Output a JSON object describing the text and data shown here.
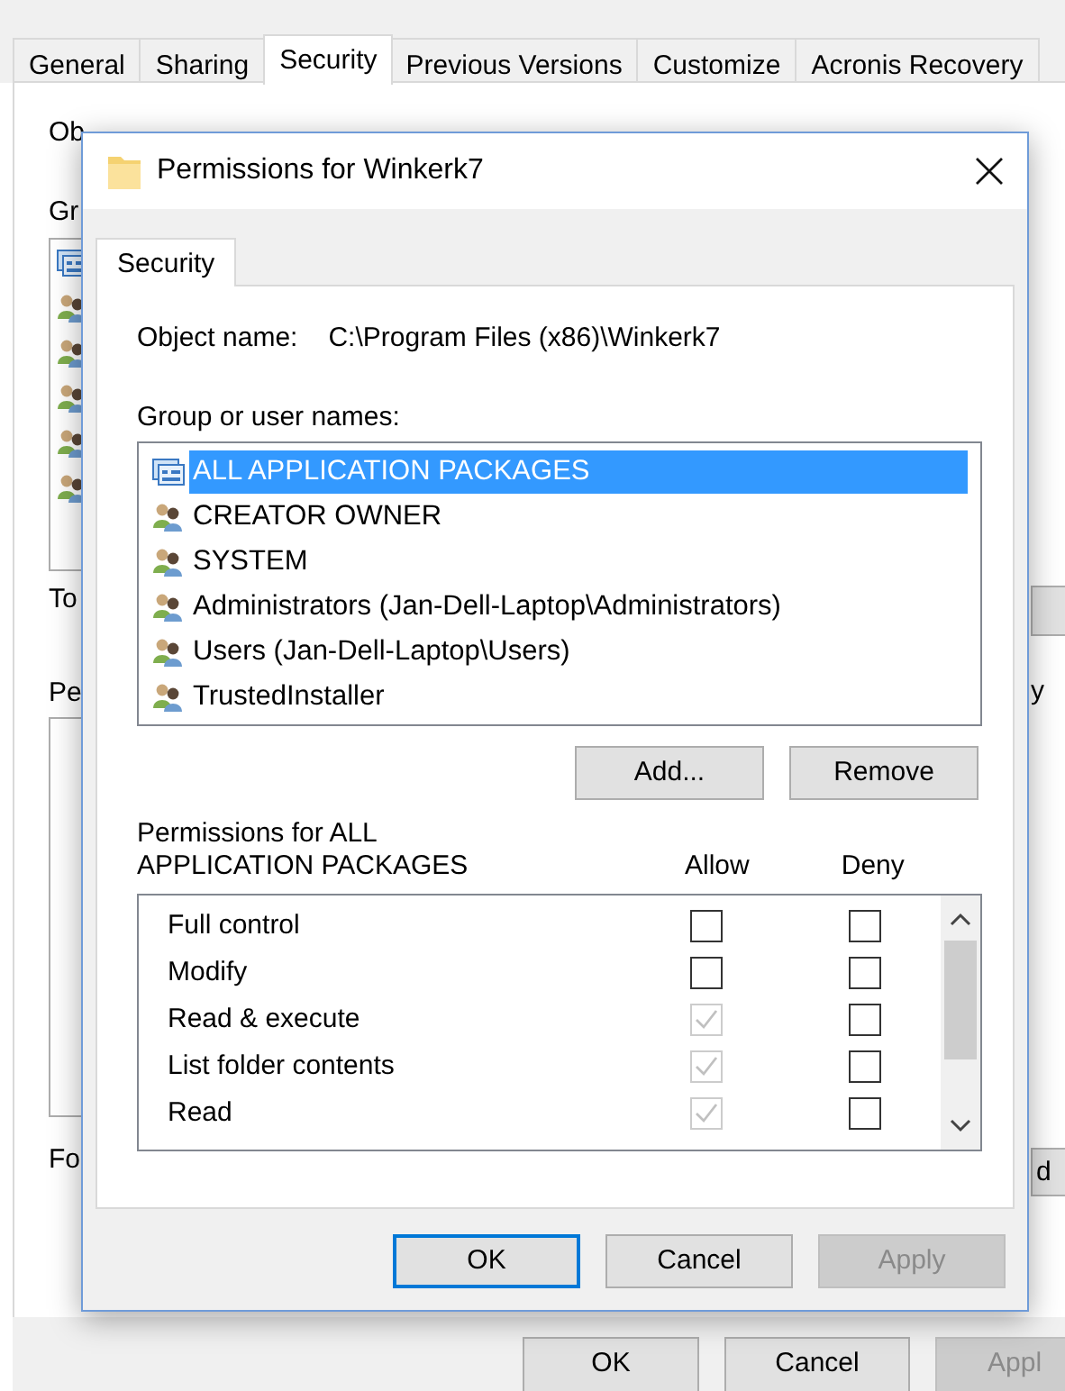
{
  "background_window": {
    "tabs": [
      {
        "label": "General",
        "selected": false
      },
      {
        "label": "Sharing",
        "selected": false
      },
      {
        "label": "Security",
        "selected": true
      },
      {
        "label": "Previous Versions",
        "selected": false
      },
      {
        "label": "Customize",
        "selected": false
      },
      {
        "label": "Acronis Recovery",
        "selected": false
      }
    ],
    "label_fragments": [
      "Ob",
      "Gr",
      "To",
      "Pe",
      "Fo"
    ],
    "right_fragments": [
      "y",
      "d"
    ],
    "buttons": [
      {
        "label": "OK",
        "disabled": false
      },
      {
        "label": "Cancel",
        "disabled": false
      },
      {
        "label": "Appl",
        "disabled": true
      }
    ]
  },
  "dialog": {
    "title": "Permissions for Winkerk7",
    "tabs": [
      {
        "label": "Security",
        "selected": true
      }
    ],
    "object_name_label": "Object name:",
    "object_name": "C:\\Program Files (x86)\\Winkerk7",
    "group_label": "Group or user names:",
    "principals": [
      {
        "name": "ALL APPLICATION PACKAGES",
        "kind": "package",
        "selected": true
      },
      {
        "name": "CREATOR OWNER",
        "kind": "group",
        "selected": false
      },
      {
        "name": "SYSTEM",
        "kind": "group",
        "selected": false
      },
      {
        "name": "Administrators (Jan-Dell-Laptop\\Administrators)",
        "kind": "group",
        "selected": false
      },
      {
        "name": "Users (Jan-Dell-Laptop\\Users)",
        "kind": "group",
        "selected": false
      },
      {
        "name": "TrustedInstaller",
        "kind": "group",
        "selected": false
      }
    ],
    "list_buttons": [
      "Add...",
      "Remove"
    ],
    "permissions_label": "Permissions for ALL APPLICATION PACKAGES",
    "columns": [
      "Allow",
      "Deny"
    ],
    "permissions": [
      {
        "name": "Full control",
        "allow": {
          "checked": false,
          "disabled": false
        },
        "deny": {
          "checked": false,
          "disabled": false
        }
      },
      {
        "name": "Modify",
        "allow": {
          "checked": false,
          "disabled": false
        },
        "deny": {
          "checked": false,
          "disabled": false
        }
      },
      {
        "name": "Read & execute",
        "allow": {
          "checked": true,
          "disabled": true
        },
        "deny": {
          "checked": false,
          "disabled": false
        }
      },
      {
        "name": "List folder contents",
        "allow": {
          "checked": true,
          "disabled": true
        },
        "deny": {
          "checked": false,
          "disabled": false
        }
      },
      {
        "name": "Read",
        "allow": {
          "checked": true,
          "disabled": true
        },
        "deny": {
          "checked": false,
          "disabled": false
        }
      }
    ],
    "buttons": [
      {
        "label": "OK",
        "default": true,
        "disabled": false
      },
      {
        "label": "Cancel",
        "default": false,
        "disabled": false
      },
      {
        "label": "Apply",
        "default": false,
        "disabled": true
      }
    ]
  }
}
